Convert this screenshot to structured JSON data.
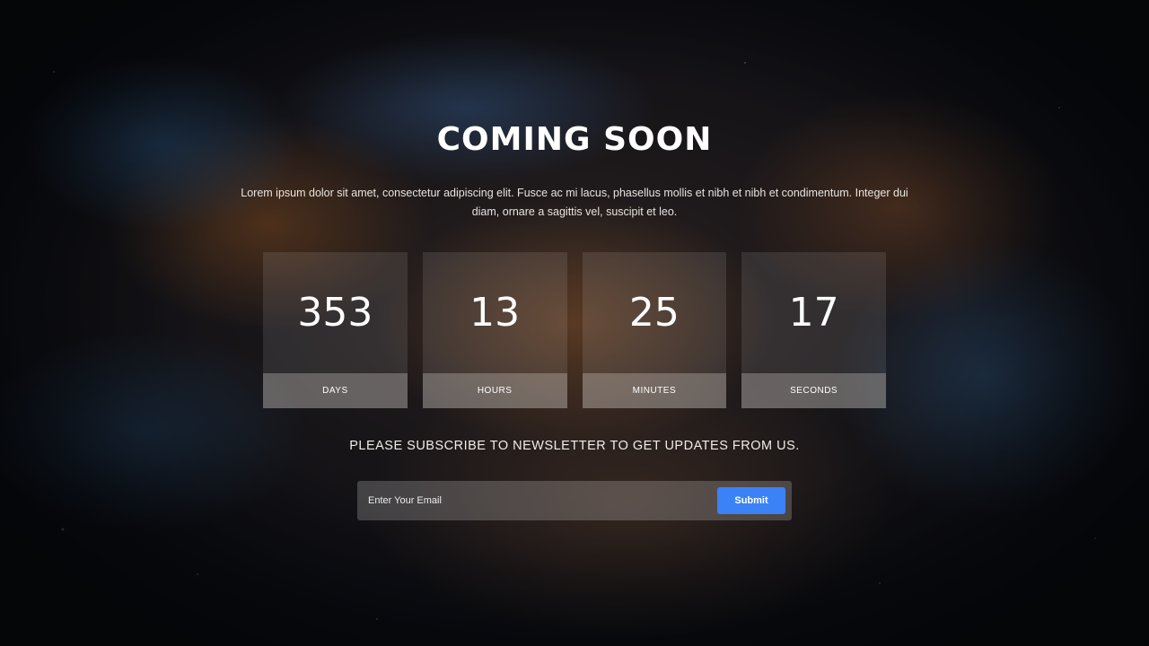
{
  "hero": {
    "title": "COMING SOON",
    "description": "Lorem ipsum dolor sit amet, consectetur adipiscing elit. Fusce ac mi lacus, phasellus mollis et nibh et nibh et condimentum. Integer dui diam, ornare a sagittis vel, suscipit et leo."
  },
  "countdown": [
    {
      "value": "353",
      "label": "DAYS"
    },
    {
      "value": "13",
      "label": "HOURS"
    },
    {
      "value": "25",
      "label": "MINUTES"
    },
    {
      "value": "17",
      "label": "SECONDS"
    }
  ],
  "newsletter": {
    "prompt": "PLEASE SUBSCRIBE TO NEWSLETTER TO GET UPDATES FROM US.",
    "email_placeholder": "Enter Your Email",
    "email_value": "",
    "submit_label": "Submit"
  },
  "colors": {
    "accent": "#3b82f6",
    "text": "#ffffff"
  }
}
